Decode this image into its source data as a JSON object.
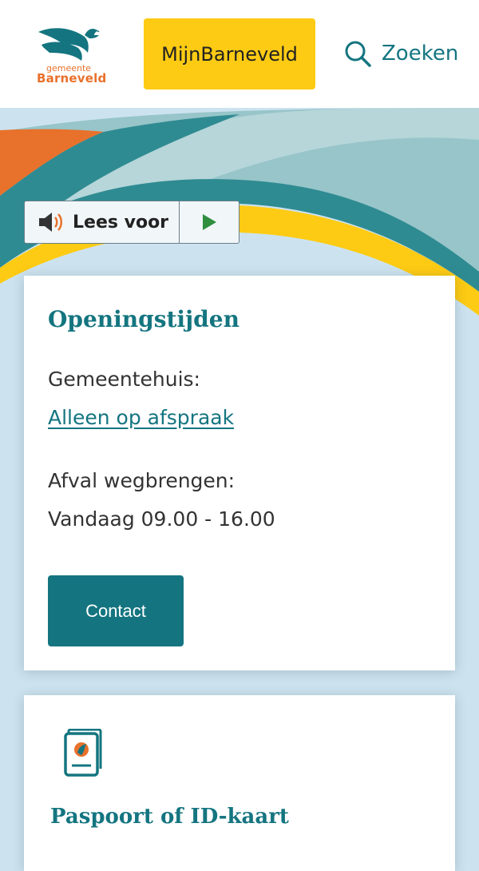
{
  "header": {
    "logo_line1": "gemeente",
    "logo_line2": "Barneveld",
    "mijn_label": "MijnBarneveld",
    "search_label": "Zoeken"
  },
  "readspeaker": {
    "label": "Lees voor"
  },
  "openingstijden": {
    "title": "Openingstijden",
    "gemeentehuis_label": "Gemeentehuis:",
    "gemeentehuis_link": "Alleen op afspraak",
    "afval_label": "Afval wegbrengen:",
    "afval_value": "Vandaag 09.00 - 16.00",
    "contact_button": "Contact"
  },
  "tile": {
    "title": "Paspoort of ID-kaart"
  },
  "colors": {
    "teal": "#147580",
    "yellow": "#fdcb13",
    "orange": "#e8712b",
    "light_blue": "#cce3ef"
  }
}
